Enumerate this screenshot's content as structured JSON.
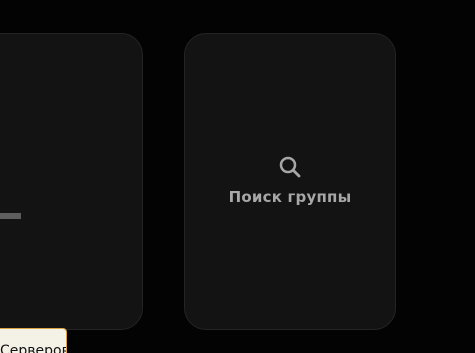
{
  "cards": {
    "create": {
      "icon": "plus-icon"
    },
    "search": {
      "icon": "search-icon",
      "label": "Поиск группы"
    }
  },
  "tooltip": {
    "text": "Серверов"
  },
  "colors": {
    "background": "#030303",
    "card": "#131313",
    "card_border": "#242424",
    "muted_text": "#a7a7a7",
    "plus_icon": "#5e5e5e",
    "tooltip_border": "#d9a441"
  }
}
